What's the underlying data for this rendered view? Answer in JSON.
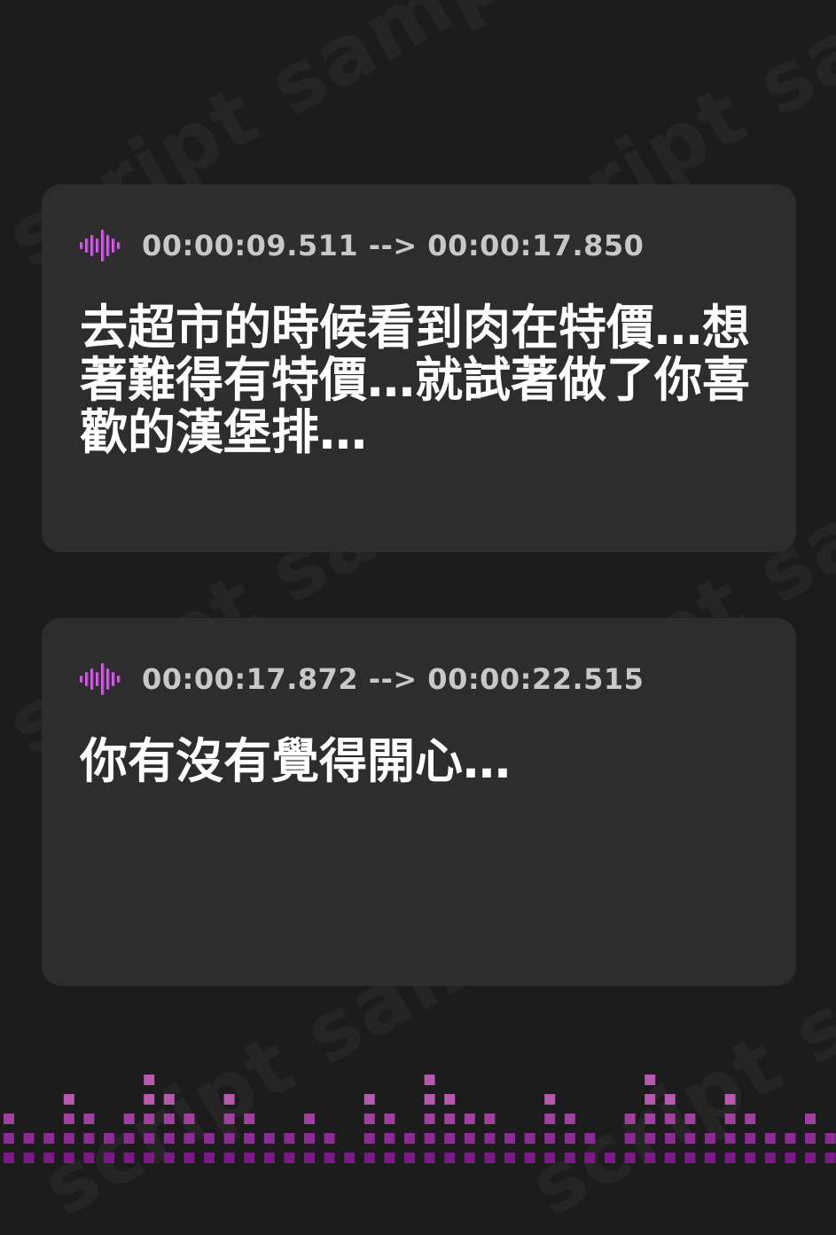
{
  "watermark_text": "script sample",
  "colors": {
    "background": "#1c1c1c",
    "card": "#2d2d2d",
    "timestamp": "#c8c8c8",
    "subtitle": "#ffffff",
    "accent": "#c050c8"
  },
  "cards": [
    {
      "icon": "sound-wave-icon",
      "timestamp": "00:00:09.511 --> 00:00:17.850",
      "text": "去超市的時候看到肉在特價…想著難得有特價…就試著做了你喜歡的漢堡排…"
    },
    {
      "icon": "sound-wave-icon",
      "timestamp": "00:00:17.872 --> 00:00:22.515",
      "text": "你有沒有覺得開心…"
    }
  ],
  "equalizer": {
    "levels": [
      2,
      1,
      1,
      3,
      2,
      1,
      2,
      4,
      3,
      2,
      1,
      3,
      2,
      1,
      1,
      2,
      1,
      0,
      3,
      2,
      1,
      4,
      3,
      2,
      2,
      1,
      1,
      3,
      2,
      1,
      0,
      2,
      4,
      3,
      2,
      1,
      3,
      2,
      1,
      1,
      2,
      1,
      3,
      1
    ]
  }
}
